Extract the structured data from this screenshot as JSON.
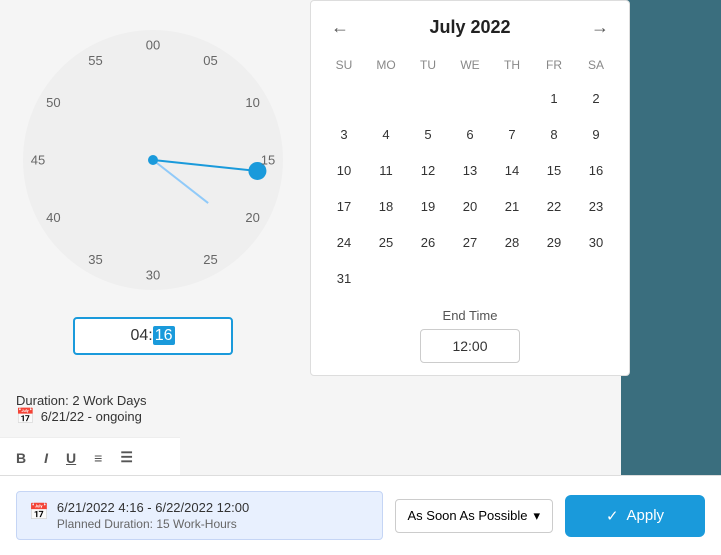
{
  "calendar": {
    "title": "July 2022",
    "prev_label": "←",
    "next_label": "→",
    "day_headers": [
      "SU",
      "MO",
      "TU",
      "WE",
      "TH",
      "FR",
      "SA"
    ],
    "weeks": [
      [
        null,
        null,
        null,
        null,
        null,
        "1",
        "2"
      ],
      [
        "3",
        "4",
        "5",
        "6",
        "7",
        "8",
        "9"
      ],
      [
        "10",
        "11",
        "12",
        "13",
        "14",
        "15",
        "16"
      ],
      [
        "17",
        "18",
        "19",
        "20",
        "21",
        "22",
        "23"
      ],
      [
        "24",
        "25",
        "26",
        "27",
        "28",
        "29",
        "30"
      ],
      [
        "31",
        null,
        null,
        null,
        null,
        null,
        null
      ]
    ],
    "end_time_label": "End Time",
    "end_time_value": "12:00"
  },
  "clock": {
    "time_display_prefix": "04:",
    "time_display_minutes": "16",
    "numbers": [
      {
        "label": "00",
        "angle": 0,
        "r": 0.82
      },
      {
        "label": "05",
        "angle": 30,
        "r": 0.82
      },
      {
        "label": "10",
        "angle": 60,
        "r": 0.82
      },
      {
        "label": "15",
        "angle": 90,
        "r": 0.82
      },
      {
        "label": "20",
        "angle": 120,
        "r": 0.82
      },
      {
        "label": "25",
        "angle": 150,
        "r": 0.82
      },
      {
        "label": "30",
        "angle": 180,
        "r": 0.82
      },
      {
        "label": "35",
        "angle": 210,
        "r": 0.82
      },
      {
        "label": "40",
        "angle": 240,
        "r": 0.82
      },
      {
        "label": "45",
        "angle": 270,
        "r": 0.82
      },
      {
        "label": "50",
        "angle": 300,
        "r": 0.82
      },
      {
        "label": "55",
        "angle": 330,
        "r": 0.82
      }
    ]
  },
  "duration": {
    "label": "Duration: 2 Work Days"
  },
  "bottom": {
    "left_date_label": "6/21/22 - ongoing",
    "date_range": "6/21/2022 4:16 - 6/22/2022 12:00",
    "planned_duration": "Planned Duration: 15 Work-Hours",
    "dropdown_label": "As Soon As Possible",
    "apply_label": "Apply"
  }
}
